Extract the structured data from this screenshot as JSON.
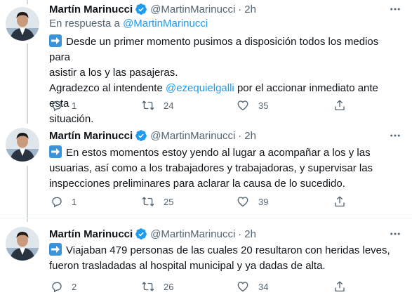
{
  "colors": {
    "link": "#1d9bf0",
    "text": "#0f1419",
    "secondary": "#536471",
    "thread_line": "#cfd9de",
    "verified": "#1d9bf0",
    "emoji_box": "#3b94d9"
  },
  "tweets": [
    {
      "author": "Martín Marinucci",
      "handle": "@MartinMarinucci",
      "separator": "·",
      "time": "2h",
      "reply_prefix": "En respuesta a",
      "reply_handle": "@MartinMarinucci",
      "lines": [
        "Desde un primer momento pusimos a disposición todos los medios para",
        "asistir a los y las pasajeras."
      ],
      "line3_pre": "Agradezco al intendente",
      "line3_mention": "@ezequielgalli",
      "line3_post": "por el accionar inmediato ante esta",
      "line4": "situación.",
      "replies": "1",
      "retweets": "24",
      "likes": "35"
    },
    {
      "author": "Martín Marinucci",
      "handle": "@MartinMarinucci",
      "separator": "·",
      "time": "2h",
      "lines": [
        "En estos momentos estoy yendo al lugar a acompañar a los y las",
        "usuarias, así como a los trabajadores y trabajadoras, y supervisar las",
        "inspecciones preliminares para aclarar la causa de lo sucedido."
      ],
      "replies": "1",
      "retweets": "25",
      "likes": "39"
    },
    {
      "author": "Martín Marinucci",
      "handle": "@MartinMarinucci",
      "separator": "·",
      "time": "2h",
      "lines": [
        "Viajaban 479 personas de las cuales 20 resultaron con heridas leves,",
        "fueron trasladadas al hospital municipal y ya dadas de alta."
      ],
      "replies": "2",
      "retweets": "26",
      "likes": "34"
    }
  ]
}
